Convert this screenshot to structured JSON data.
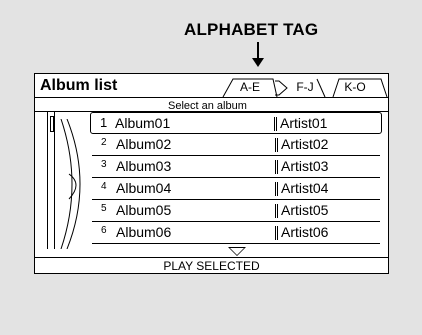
{
  "callout": {
    "label": "ALPHABET TAG"
  },
  "screen": {
    "title": "Album list",
    "subtitle": "Select an album",
    "tabs": [
      {
        "label": "A-E",
        "active": true
      },
      {
        "label": "F-J",
        "active": false
      },
      {
        "label": "K-O",
        "active": false
      }
    ],
    "rows": [
      {
        "num": "1",
        "album": "Album01",
        "artist": "Artist01",
        "selected": true
      },
      {
        "num": "2",
        "album": "Album02",
        "artist": "Artist02",
        "selected": false
      },
      {
        "num": "3",
        "album": "Album03",
        "artist": "Artist03",
        "selected": false
      },
      {
        "num": "4",
        "album": "Album04",
        "artist": "Artist04",
        "selected": false
      },
      {
        "num": "5",
        "album": "Album05",
        "artist": "Artist05",
        "selected": false
      },
      {
        "num": "6",
        "album": "Album06",
        "artist": "Artist06",
        "selected": false
      }
    ],
    "footer": "PLAY SELECTED"
  }
}
